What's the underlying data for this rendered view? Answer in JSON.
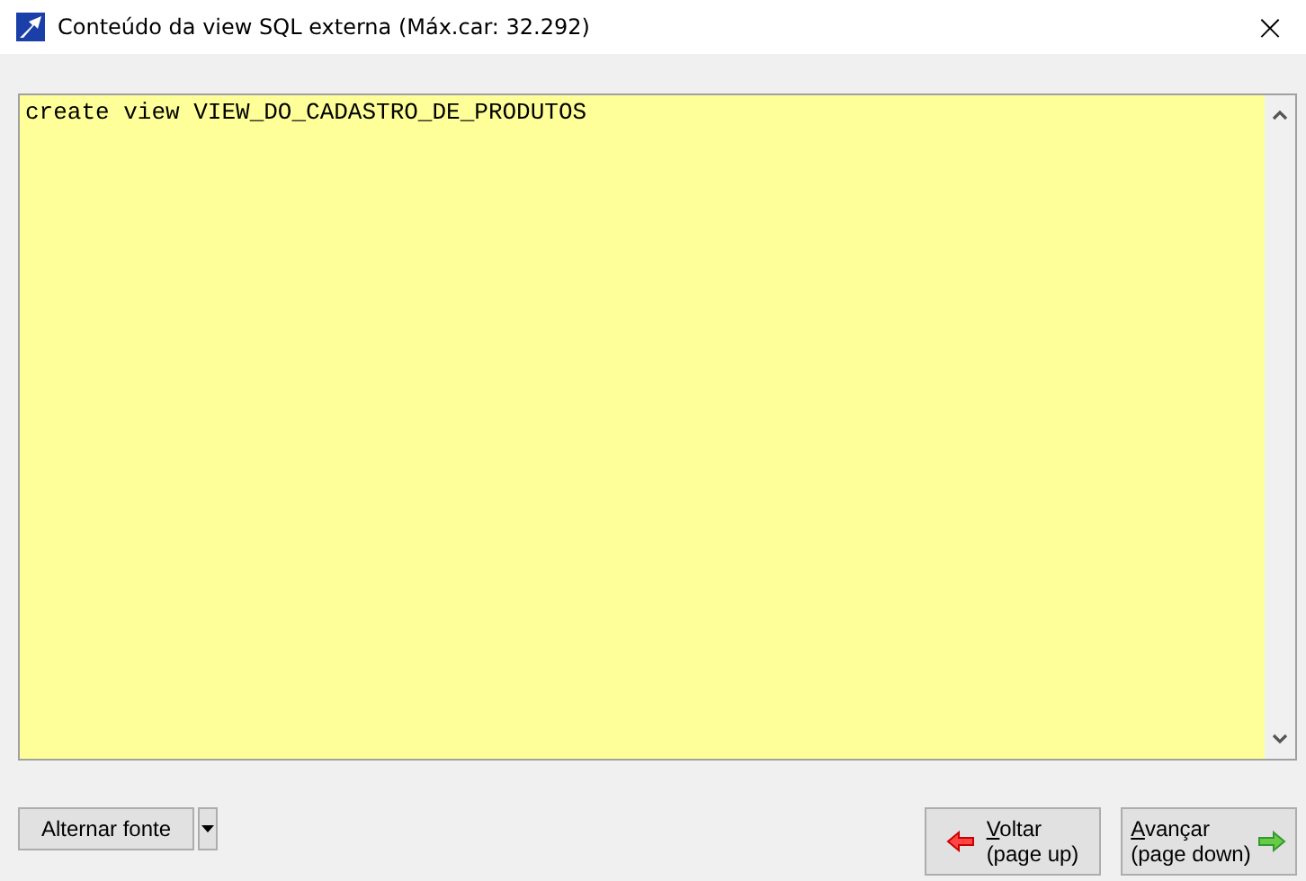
{
  "window": {
    "title": "Conteúdo da view SQL externa (Máx.car: 32.292)",
    "close": "×"
  },
  "editor": {
    "value": "create view VIEW_DO_CADASTRO_DE_PRODUTOS"
  },
  "buttons": [
    {
      "kind": "font",
      "label": "Alternar fonte"
    },
    {
      "kind": "back",
      "line1": "Voltar",
      "line2": "(page up)"
    },
    {
      "kind": "next",
      "line1": "Avançar",
      "line2": "(page down)"
    }
  ]
}
